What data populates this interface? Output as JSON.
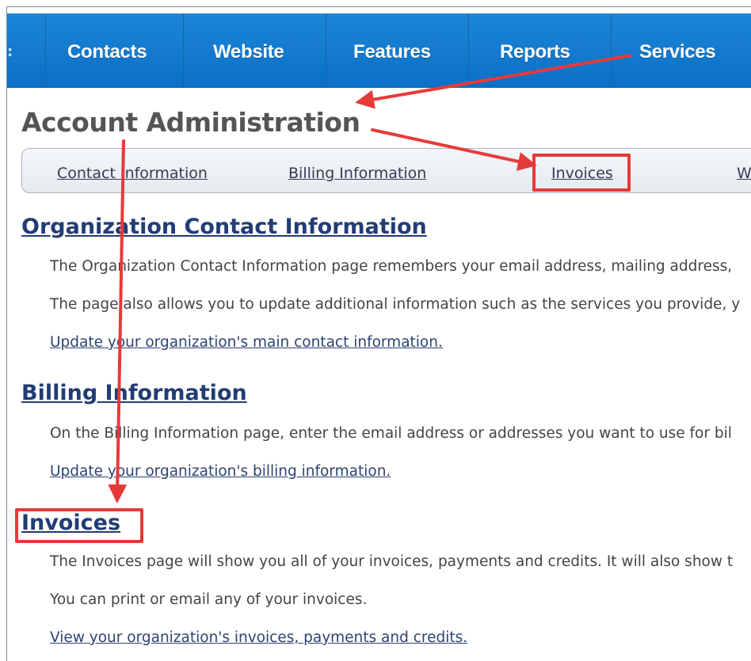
{
  "nav": {
    "stub": ":",
    "items": [
      {
        "label": "Contacts"
      },
      {
        "label": "Website"
      },
      {
        "label": "Features"
      },
      {
        "label": "Reports"
      },
      {
        "label": "Services"
      }
    ]
  },
  "page": {
    "title": "Account Administration"
  },
  "subnav": {
    "items": [
      {
        "label": "Contact Information"
      },
      {
        "label": "Billing Information"
      },
      {
        "label": "Invoices"
      },
      {
        "label": "W"
      }
    ]
  },
  "sections": {
    "contact": {
      "heading": "Organization Contact Information",
      "p1": "The Organization Contact Information page remembers your email address, mailing address,",
      "p2": "The page also allows you to update additional information such as the services you provide, y",
      "link": "Update your organization's main contact information."
    },
    "billing": {
      "heading": "Billing Information",
      "p1": "On the Billing Information page, enter the email address or addresses you want to use for bil",
      "link": "Update your organization's billing information."
    },
    "invoices": {
      "heading": "Invoices",
      "p1": "The Invoices page will show you all of your invoices, payments and credits. It will also show t",
      "p2": "You can print or email any of your invoices.",
      "link": "View your organization's invoices, payments and credits."
    }
  },
  "colors": {
    "nav_bg": "#0a6fc6",
    "annotation": "#e63a3a",
    "heading": "#223d73"
  }
}
